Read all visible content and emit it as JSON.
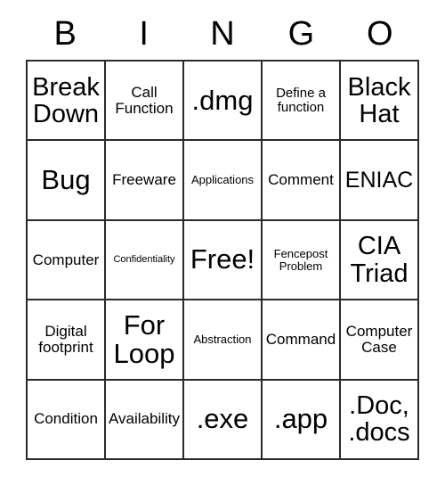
{
  "card": {
    "title": "BINGO",
    "header_letters": [
      "B",
      "I",
      "N",
      "G",
      "O"
    ],
    "columns": 5,
    "rows": 5,
    "border_color": "#2b2b2b",
    "background_color": "#ffffff",
    "text_color": "#000000",
    "free_space": "Free!",
    "cells": [
      [
        {
          "text": "Break Down",
          "size": "xl"
        },
        {
          "text": "Call Function",
          "size": "m"
        },
        {
          "text": ".dmg",
          "size": "xxl"
        },
        {
          "text": "Define a function",
          "size": "s"
        },
        {
          "text": "Black Hat",
          "size": "xl"
        }
      ],
      [
        {
          "text": "Bug",
          "size": "xxl"
        },
        {
          "text": "Freeware",
          "size": "m"
        },
        {
          "text": "Applications",
          "size": "xs"
        },
        {
          "text": "Comment",
          "size": "m"
        },
        {
          "text": "ENIAC",
          "size": "l"
        }
      ],
      [
        {
          "text": "Computer",
          "size": "m"
        },
        {
          "text": "Confidentiality",
          "size": "xxs"
        },
        {
          "text": "Free!",
          "size": "xxl"
        },
        {
          "text": "Fencepost Problem",
          "size": "xs"
        },
        {
          "text": "CIA Triad",
          "size": "xl"
        }
      ],
      [
        {
          "text": "Digital footprint",
          "size": "m"
        },
        {
          "text": "For Loop",
          "size": "xxl"
        },
        {
          "text": "Abstraction",
          "size": "xs"
        },
        {
          "text": "Command",
          "size": "m"
        },
        {
          "text": "Computer Case",
          "size": "m"
        }
      ],
      [
        {
          "text": "Condition",
          "size": "m"
        },
        {
          "text": "Availability",
          "size": "m"
        },
        {
          "text": ".exe",
          "size": "xxl"
        },
        {
          "text": ".app",
          "size": "xxl"
        },
        {
          "text": ".Doc, .docs",
          "size": "xl"
        }
      ]
    ]
  }
}
